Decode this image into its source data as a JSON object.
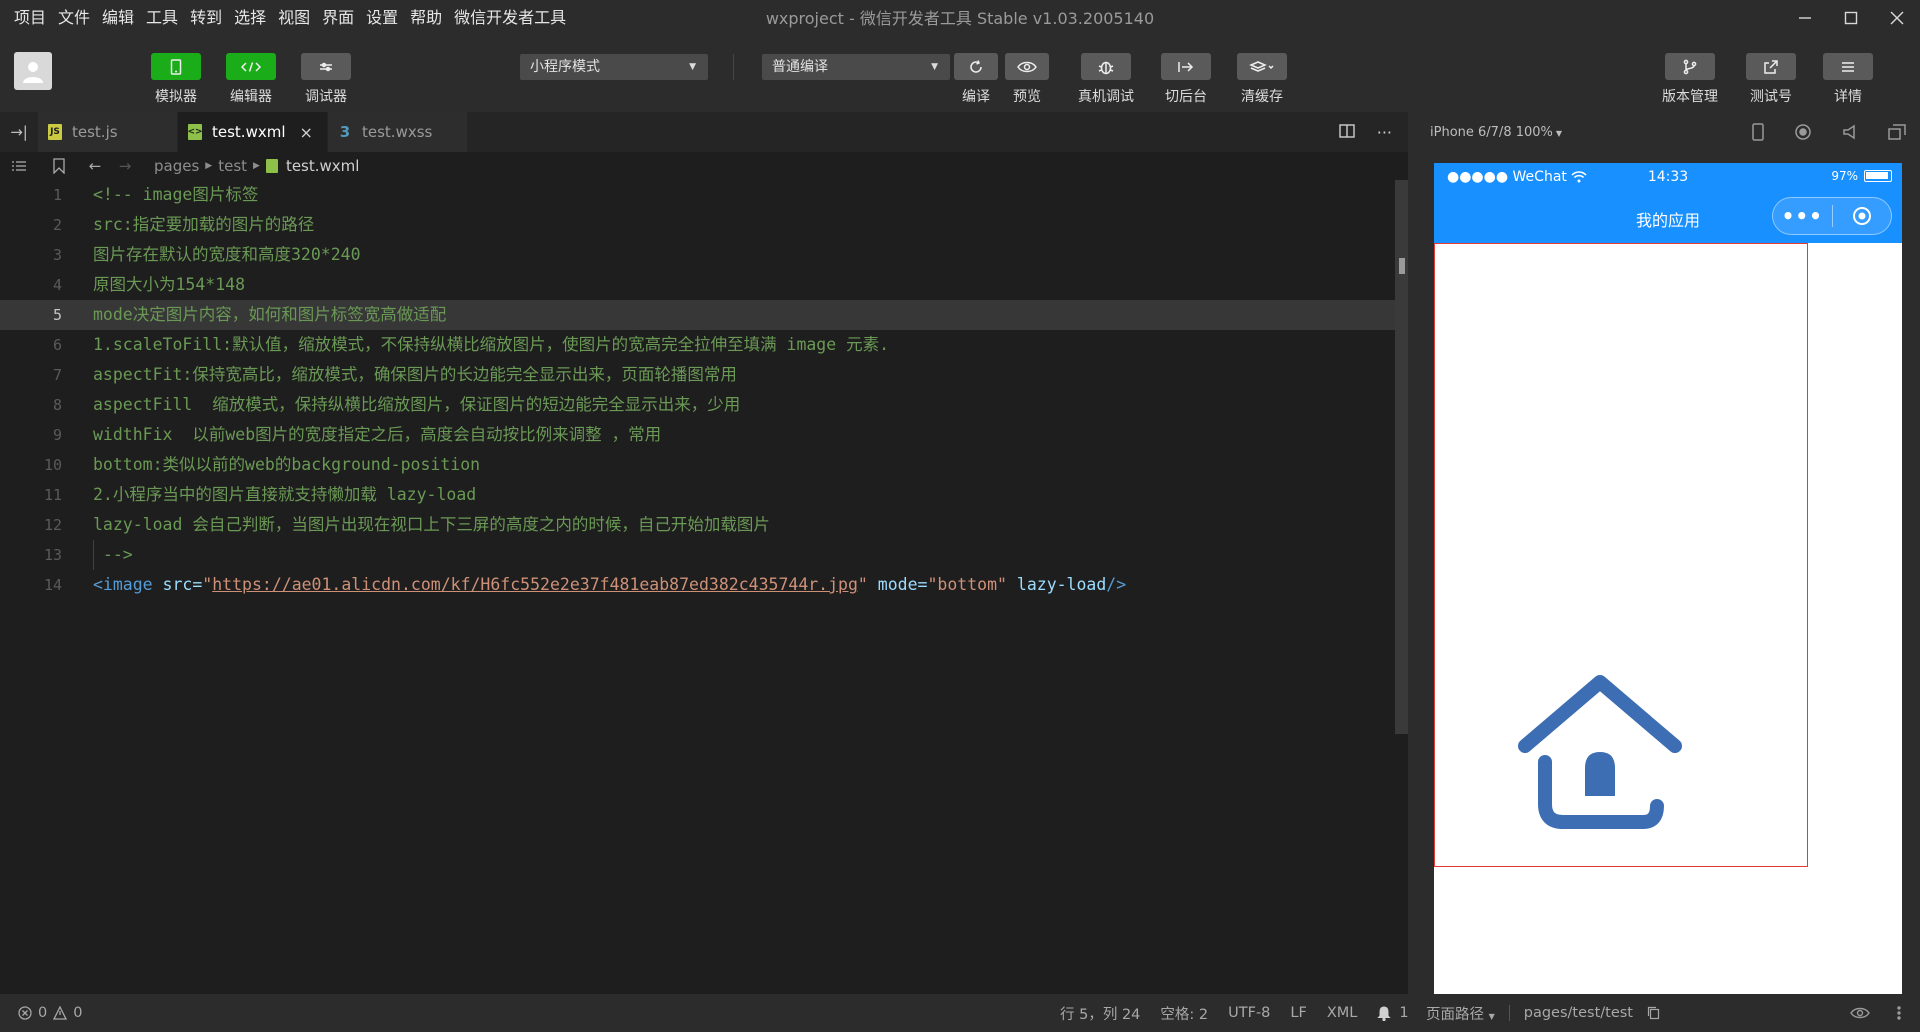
{
  "window": {
    "title": "wxproject - 微信开发者工具 Stable v1.03.2005140",
    "menus": [
      "项目",
      "文件",
      "编辑",
      "工具",
      "转到",
      "选择",
      "视图",
      "界面",
      "设置",
      "帮助",
      "微信开发者工具"
    ]
  },
  "toolbar": {
    "simulator_label": "模拟器",
    "editor_label": "编辑器",
    "debugger_label": "调试器",
    "mode_select": "小程序模式",
    "compile_select": "普通编译",
    "compile_label": "编译",
    "preview_label": "预览",
    "remote_debug_label": "真机调试",
    "background_label": "切后台",
    "clear_cache_label": "清缓存",
    "version_label": "版本管理",
    "test_number_label": "测试号",
    "details_label": "详情"
  },
  "tabs": [
    {
      "label": "test.js",
      "icon": "JS",
      "color": "#cbcb41"
    },
    {
      "label": "test.wxml",
      "icon": "wxml",
      "color": "#8dc149"
    },
    {
      "label": "test.wxss",
      "icon": "css",
      "color": "#519aba"
    }
  ],
  "breadcrumb": {
    "parts": [
      "pages",
      "test",
      "test.wxml"
    ]
  },
  "editor": {
    "highlighted_line": 5,
    "lines": [
      "<!-- image图片标签",
      "src:指定要加载的图片的路径",
      "图片存在默认的宽度和高度320*240",
      "原图大小为154*148",
      "mode决定图片内容，如何和图片标签宽高做适配",
      "1.scaleToFill:默认值，缩放模式，不保持纵横比缩放图片，使图片的宽高完全拉伸至填满 image 元素.",
      "aspectFit:保持宽高比，缩放模式，确保图片的长边能完全显示出来，页面轮播图常用",
      "aspectFill  缩放模式，保持纵横比缩放图片，保证图片的短边能完全显示出来，少用",
      "widthFix  以前web图片的宽度指定之后，高度会自动按比例来调整 ，常用",
      "bottom:类似以前的web的background-position",
      "2.小程序当中的图片直接就支持懒加载 lazy-load",
      "lazy-load 会自己判断，当图片出现在视口上下三屏的高度之内的时候，自己开始加载图片",
      " -->"
    ],
    "line_numbers": [
      "1",
      "2",
      "3",
      "4",
      "5",
      "6",
      "7",
      "8",
      "9",
      "10",
      "11",
      "12",
      "13",
      "14"
    ],
    "last_line": {
      "open": "<image",
      "src_attr": " src=",
      "q1": "\"",
      "src_value": "https://ae01.alicdn.com/kf/H6fc552e2e37f481eab87ed382c435744r.jpg",
      "q2": "\"",
      "mode_attr": " mode=",
      "mode_value": "\"bottom\"",
      "lazy_attr": " lazy-load",
      "close": "/>"
    }
  },
  "simulator": {
    "device": "iPhone 6/7/8 100%",
    "carrier": "●●●●● WeChat",
    "time": "14:33",
    "battery": "97%",
    "battery_level": 0.97,
    "page_title": "我的应用",
    "capsule_more": "•••"
  },
  "statusbar": {
    "errors": "0",
    "warnings": "0",
    "position": "行 5，列 24",
    "spaces": "空格: 2",
    "encoding": "UTF-8",
    "eol": "LF",
    "language": "XML",
    "notifications": "1",
    "page_path_label": "页面路径",
    "page_path": "pages/test/test"
  },
  "colors": {
    "accent_green": "#1aad19",
    "wechat_blue": "#1890ff",
    "image_border": "#e53935",
    "house_icon": "#3d6eb4"
  }
}
